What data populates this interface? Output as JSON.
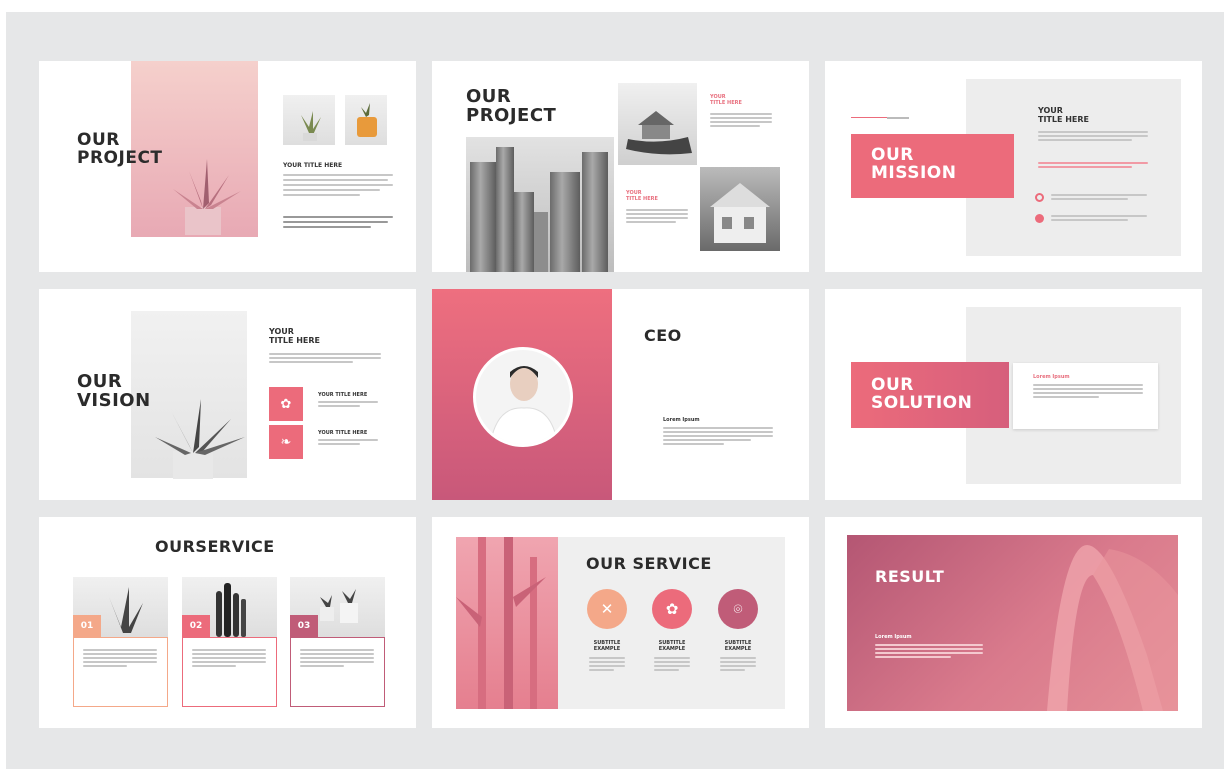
{
  "slides": {
    "project1": {
      "title_l1": "OUR",
      "title_l2": "PROJECT",
      "subtitle": "YOUR TITLE HERE"
    },
    "project2": {
      "title_l1": "OUR",
      "title_l2": "PROJECT",
      "cap1_l1": "YOUR",
      "cap1_l2": "TITLE HERE",
      "cap2_l1": "YOUR",
      "cap2_l2": "TITLE HERE"
    },
    "mission": {
      "title_l1": "OUR",
      "title_l2": "MISSION",
      "subtitle_l1": "YOUR",
      "subtitle_l2": "TITLE HERE"
    },
    "vision": {
      "title_l1": "OUR",
      "title_l2": "VISION",
      "subtitle_l1": "YOUR",
      "subtitle_l2": "TITLE HERE",
      "item1": "YOUR TITLE HERE",
      "item2": "YOUR TITLE HERE"
    },
    "ceo": {
      "title": "CEO",
      "label": "Lorem Ipsum"
    },
    "solution": {
      "title_l1": "OUR",
      "title_l2": "SOLUTION",
      "card_label": "Lorem Ipsum"
    },
    "service1": {
      "title": "OURSERVICE",
      "n1": "01",
      "n2": "02",
      "n3": "03"
    },
    "service2": {
      "title": "OUR SERVICE",
      "items": [
        {
          "l1": "SUBTITLE",
          "l2": "EXAMPLE"
        },
        {
          "l1": "SUBTITLE",
          "l2": "EXAMPLE"
        },
        {
          "l1": "SUBTITLE",
          "l2": "EXAMPLE"
        }
      ]
    },
    "result": {
      "title": "RESULT",
      "label": "Lorem Ipsum"
    }
  },
  "colors": {
    "background": "#e6e7e8",
    "pink_accent": "#ec6b7b",
    "pink_soft": "#f1b5c0",
    "peach": "#f4a889",
    "mauve": "#c05c78",
    "text_dark": "#2b2b2b"
  },
  "icons": [
    "plant-icon",
    "building-icon",
    "house-icon",
    "person-icon",
    "gear-icon",
    "leaf-icon",
    "cross-icon",
    "pin-icon"
  ]
}
